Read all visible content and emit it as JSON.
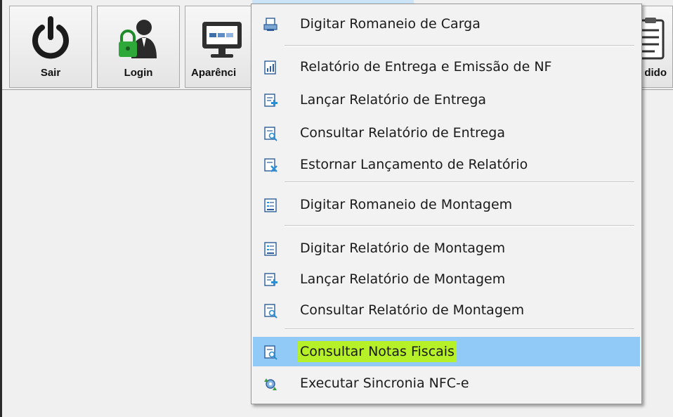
{
  "toolbar": {
    "buttons": [
      {
        "label": "Sair",
        "icon": "power-icon"
      },
      {
        "label": "Login",
        "icon": "user-lock-icon"
      },
      {
        "label": "Aparênci",
        "icon": "monitor-icon"
      },
      {
        "label": "dido",
        "icon": "clipboard-icon"
      }
    ]
  },
  "menu": {
    "items": [
      {
        "label": "Digitar Romaneio de Carga",
        "icon": "printer-doc-icon"
      },
      {
        "label": "Relatório de Entrega e Emissão de NF",
        "icon": "report-chart-icon"
      },
      {
        "label": "Lançar Relatório de Entrega",
        "icon": "doc-add-icon"
      },
      {
        "label": "Consultar Relatório de Entrega",
        "icon": "doc-search-icon"
      },
      {
        "label": "Estornar Lançamento de Relatório",
        "icon": "doc-reverse-icon"
      },
      {
        "label": "Digitar Romaneio de Montagem",
        "icon": "doc-list-icon"
      },
      {
        "label": "Digitar Relatório de Montagem",
        "icon": "doc-list-icon"
      },
      {
        "label": "Lançar Relatório de Montagem",
        "icon": "doc-add-icon"
      },
      {
        "label": "Consultar Relatório de Montagem",
        "icon": "doc-search-icon"
      },
      {
        "label": "Consultar Notas Fiscais",
        "icon": "doc-search-icon"
      },
      {
        "label": "Executar Sincronia NFC-e",
        "icon": "sync-gear-icon"
      }
    ],
    "selected_label": "Consultar Notas Fiscais"
  },
  "colors": {
    "selected_bg": "#91c9f7",
    "highlight_marker": "#b5f028",
    "menu_bg": "#f2f2f2"
  }
}
